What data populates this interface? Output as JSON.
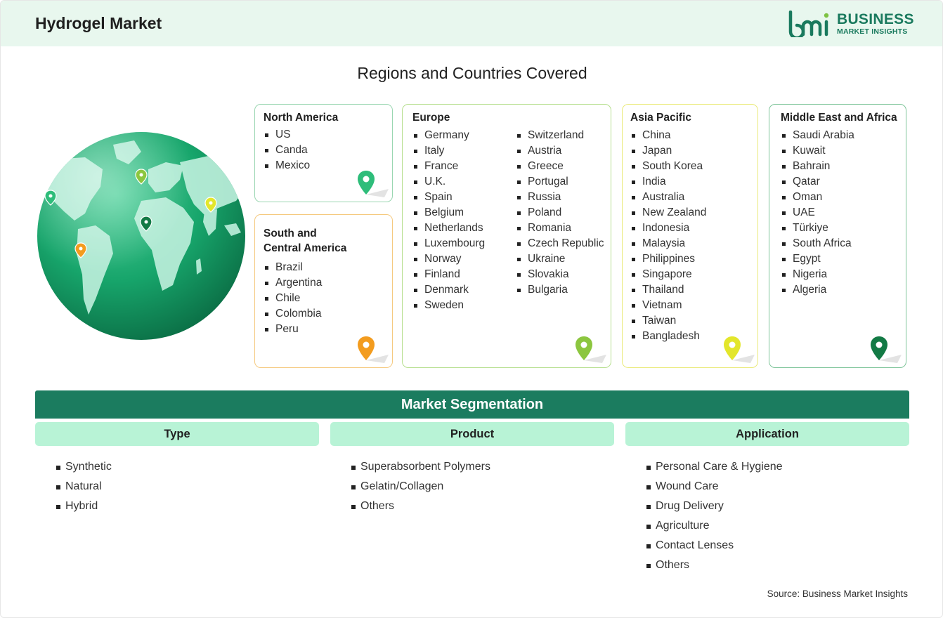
{
  "header": {
    "title": "Hydrogel Market",
    "logo": {
      "line1": "BUSINESS",
      "line2": "MARKET INSIGHTS"
    }
  },
  "regions_section": {
    "title": "Regions and Countries Covered",
    "regions": {
      "north_america": {
        "name": "North America",
        "countries": [
          "US",
          "Canda",
          "Mexico"
        ],
        "pin_color": "#2ebd7a"
      },
      "south_central_america": {
        "name_line1": "South and",
        "name_line2": "Central America",
        "countries": [
          "Brazil",
          "Argentina",
          "Chile",
          "Colombia",
          "Peru"
        ],
        "pin_color": "#f39c1f"
      },
      "europe": {
        "name": "Europe",
        "countries_col1": [
          "Germany",
          "Italy",
          "France",
          "U.K.",
          "Spain",
          "Belgium",
          "Netherlands",
          "Luxembourg",
          "Norway",
          "Finland",
          "Denmark",
          "Sweden"
        ],
        "countries_col2": [
          "Switzerland",
          "Austria",
          "Greece",
          "Portugal",
          "Russia",
          "Poland",
          "Romania",
          "Czech Republic",
          "Ukraine",
          "Slovakia",
          "Bulgaria"
        ],
        "pin_color": "#8cc63f"
      },
      "asia_pacific": {
        "name": "Asia Pacific",
        "countries": [
          "China",
          "Japan",
          "South Korea",
          "India",
          "Australia",
          "New Zealand",
          "Indonesia",
          "Malaysia",
          "Philippines",
          "Singapore",
          "Thailand",
          "Vietnam",
          "Taiwan",
          "Bangladesh"
        ],
        "pin_color": "#e3e62b"
      },
      "middle_east_africa": {
        "name": "Middle East and Africa",
        "countries": [
          "Saudi Arabia",
          "Kuwait",
          "Bahrain",
          "Qatar",
          "Oman",
          "UAE",
          "Türkiye",
          "South Africa",
          "Egypt",
          "Nigeria",
          "Algeria"
        ],
        "pin_color": "#137a45"
      }
    }
  },
  "segmentation": {
    "title": "Market Segmentation",
    "columns": {
      "type": {
        "header": "Type",
        "items": [
          "Synthetic",
          "Natural",
          "Hybrid"
        ]
      },
      "product": {
        "header": "Product",
        "items": [
          "Superabsorbent Polymers",
          "Gelatin/Collagen",
          "Others"
        ]
      },
      "application": {
        "header": "Application",
        "items": [
          "Personal Care & Hygiene",
          "Wound Care",
          "Drug Delivery",
          "Agriculture",
          "Contact Lenses",
          "Others"
        ]
      }
    }
  },
  "source": "Source: Business Market Insights",
  "colors": {
    "brand_green": "#1b7c5f",
    "header_bg": "#e8f7ee",
    "segment_header_bg": "#b8f3d6"
  }
}
